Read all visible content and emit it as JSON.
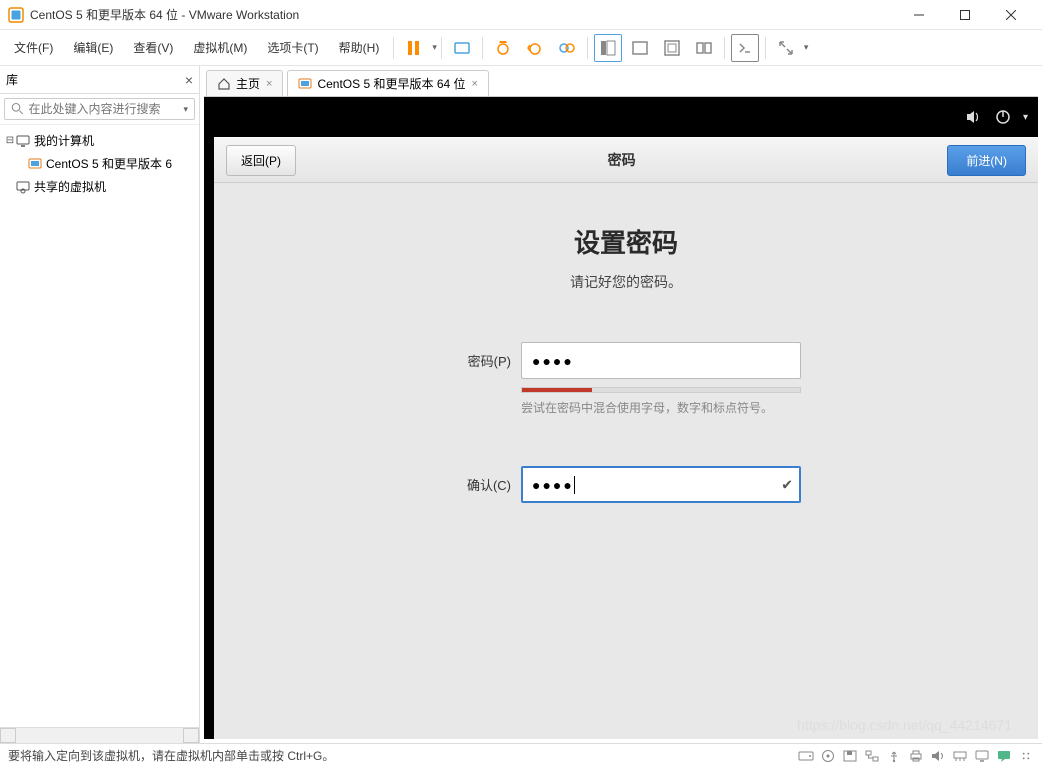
{
  "titlebar": {
    "title": "CentOS 5 和更早版本 64 位 - VMware Workstation"
  },
  "menubar": {
    "file": "文件(F)",
    "edit": "编辑(E)",
    "view": "查看(V)",
    "vm": "虚拟机(M)",
    "tabs": "选项卡(T)",
    "help": "帮助(H)"
  },
  "library": {
    "title": "库",
    "search_placeholder": "在此处键入内容进行搜索",
    "my_computer": "我的计算机",
    "vm_item": "CentOS 5 和更早版本 6",
    "shared_vms": "共享的虚拟机"
  },
  "tabs": {
    "home": "主页",
    "vm": "CentOS 5 和更早版本 64 位"
  },
  "centos": {
    "back": "返回(P)",
    "header_title": "密码",
    "next": "前进(N)",
    "heading": "设置密码",
    "subheading": "请记好您的密码。",
    "password_label": "密码(P)",
    "password_value": "●●●●",
    "hint": "尝试在密码中混合使用字母，数字和标点符号。",
    "confirm_label": "确认(C)",
    "confirm_value": "●●●●"
  },
  "status": {
    "text": "要将输入定向到该虚拟机，请在虚拟机内部单击或按 Ctrl+G。"
  },
  "watermark": "https://blog.csdn.net/qq_44214671"
}
